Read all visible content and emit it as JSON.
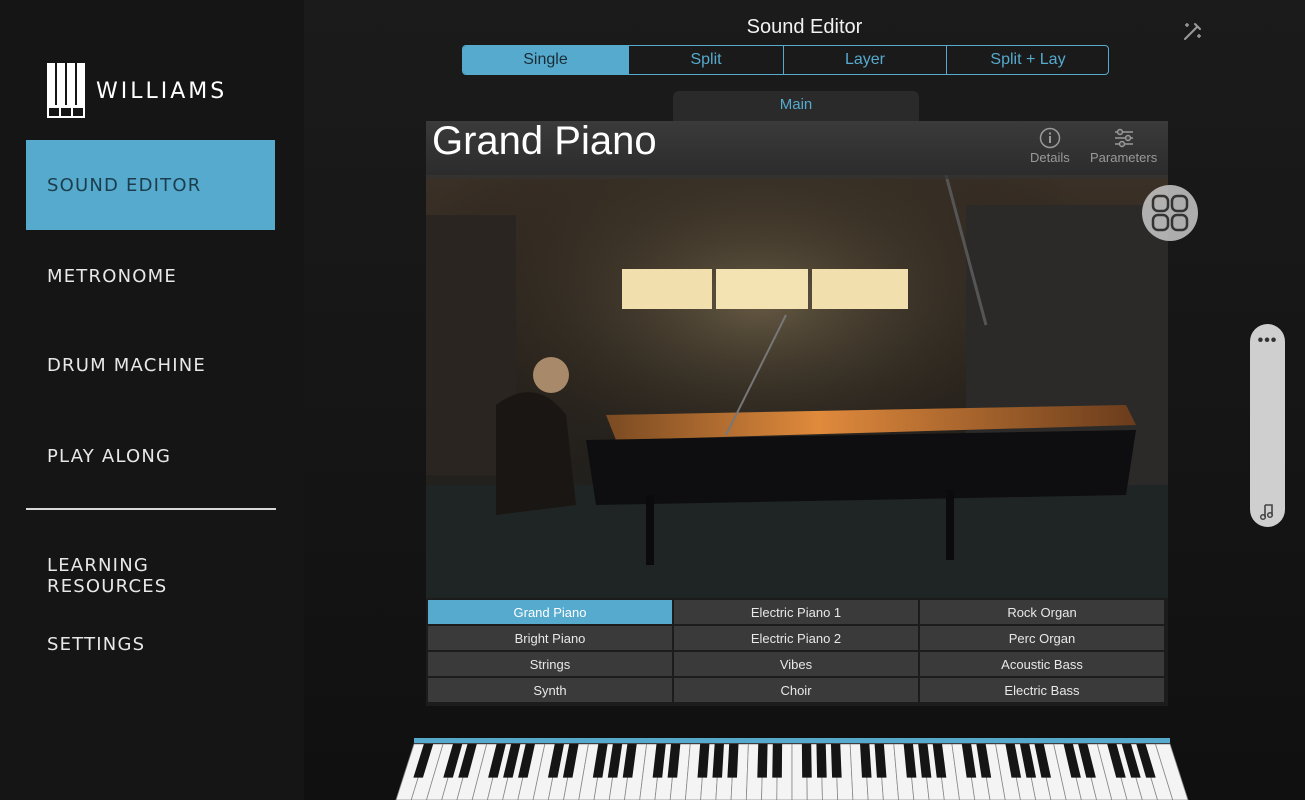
{
  "brand": {
    "name": "WILLIAMS"
  },
  "sidebar": {
    "items": [
      {
        "label": "SOUND EDITOR",
        "active": true
      },
      {
        "label": "METRONOME"
      },
      {
        "label": "DRUM MACHINE"
      },
      {
        "label": "PLAY ALONG"
      },
      {
        "label": "LEARNING\nRESOURCES"
      },
      {
        "label": "SETTINGS"
      }
    ]
  },
  "header": {
    "title": "Sound Editor",
    "tune_icon": "tune-icon"
  },
  "mode_tabs": [
    {
      "label": "Single",
      "active": true
    },
    {
      "label": "Split"
    },
    {
      "label": "Layer"
    },
    {
      "label": "Split + Lay"
    }
  ],
  "panel": {
    "tab_label": "Main",
    "sound_name": "Grand Piano",
    "details_label": "Details",
    "parameters_label": "Parameters"
  },
  "sounds": [
    [
      "Grand Piano",
      "Electric Piano 1",
      "Rock Organ"
    ],
    [
      "Bright Piano",
      "Electric Piano 2",
      "Perc Organ"
    ],
    [
      "Strings",
      "Vibes",
      "Acoustic Bass"
    ],
    [
      "Synth",
      "Choir",
      "Electric Bass"
    ]
  ],
  "selected_sound": "Grand Piano",
  "colors": {
    "accent": "#55aace",
    "sidebar_bg": "#151515",
    "cell_bg": "#3a3a3a"
  },
  "icons": {
    "details": "info-icon",
    "parameters": "sliders-icon",
    "grid": "grid-icon",
    "more": "more-dots-icon",
    "note": "music-note-icon"
  }
}
